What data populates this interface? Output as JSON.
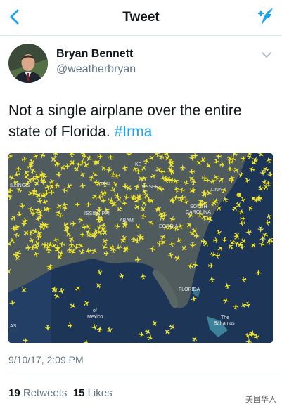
{
  "header": {
    "title": "Tweet",
    "back_icon": "chevron-left-icon",
    "compose_icon": "compose-tweet-icon",
    "accent": "#1da1f2"
  },
  "author": {
    "name": "Bryan Bennett",
    "handle": "@weatherbryan"
  },
  "tweet": {
    "text_before": "Not a single airplane over the entire state of Florida. ",
    "hashtag": "#Irma",
    "timestamp": "9/10/17, 2:09 PM"
  },
  "map": {
    "labels": [
      "KE",
      "ILLINOIS",
      "TEN",
      "ESSEE",
      "SOUTH",
      "CAROLINA",
      "LINA",
      "ISSISSIPPI",
      "ABAM",
      "EORGIA",
      "FLORIDA",
      "The",
      "Bahamas",
      "of",
      "Mexico",
      "AS"
    ],
    "plane_color": "#f1e72b"
  },
  "stats": {
    "retweets_count": "19",
    "retweets_label": "Retweets",
    "likes_count": "15",
    "likes_label": "Likes"
  },
  "watermark": "美国华人"
}
